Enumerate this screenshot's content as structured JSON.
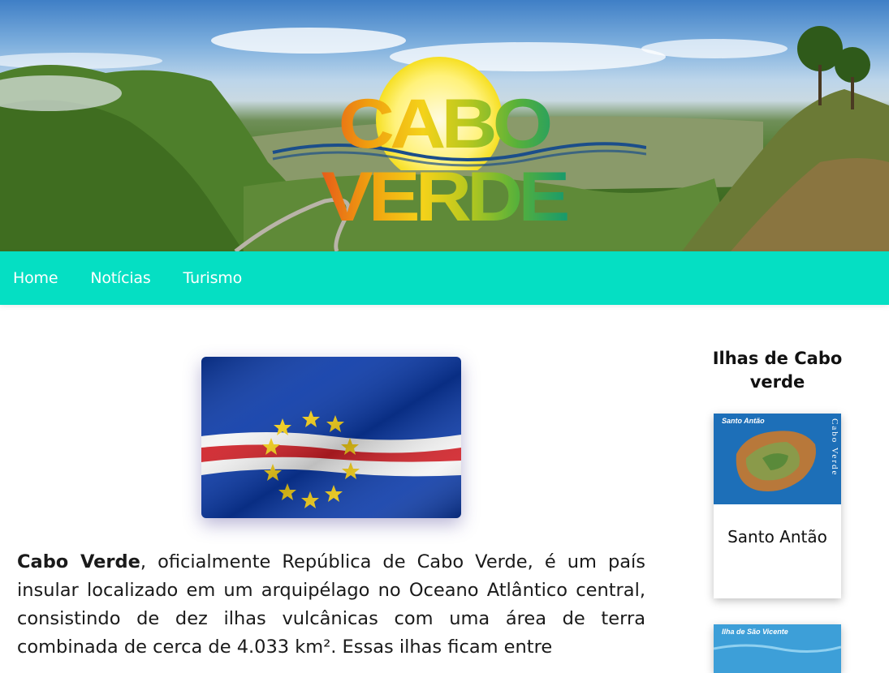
{
  "header": {
    "logo_text": "CABO VERDE"
  },
  "nav": {
    "items": [
      "Home",
      "Notícias",
      "Turismo"
    ]
  },
  "main": {
    "article_bold": "Cabo Verde",
    "article_text": ", oficialmente República de Cabo Verde, é um país insular localizado em um arquipélago no Oceano Atlântico central, consistindo de dez ilhas vulcânicas com uma área de terra combinada de cerca de 4.033 km². Essas ilhas ficam entre"
  },
  "sidebar": {
    "title": "Ilhas de Cabo verde",
    "cards": [
      {
        "label": "Santo Antão",
        "map_title": "Santo Antão",
        "map_side": "Cabo Verde"
      },
      {
        "label": "",
        "map_title": "Ilha de São Vicente",
        "map_side": ""
      }
    ]
  },
  "colors": {
    "nav_bg": "#05dfc3",
    "flag_blue": "#0b3aa8",
    "flag_red": "#cf2027",
    "flag_star": "#f7d116"
  }
}
